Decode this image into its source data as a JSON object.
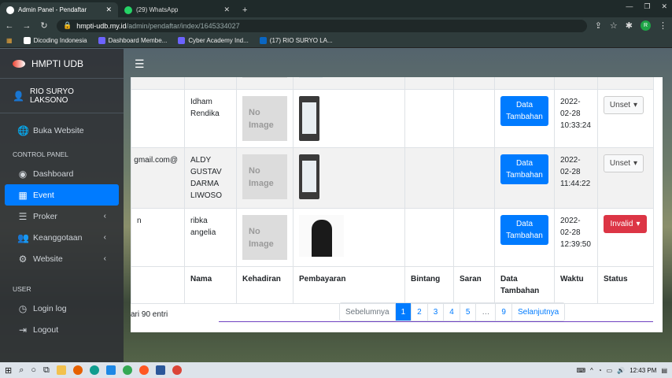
{
  "browser": {
    "tabs": [
      {
        "title": "Admin Panel - Pendaftar",
        "active": true
      },
      {
        "title": "(29) WhatsApp",
        "active": false
      }
    ],
    "url_host": "hmpti-udb.my.id",
    "url_path": "/admin/pendaftar/index/1645334027",
    "profile_initial": "R",
    "bookmarks": [
      "Dicoding Indonesia",
      "Dashboard Membe...",
      "Cyber Academy Ind...",
      "(17) RIO SURYO LA..."
    ]
  },
  "sidebar": {
    "brand": "HMPTI UDB",
    "user": "RIO SURYO LAKSONO",
    "visit_site": "Buka Website",
    "section_control": "CONTROL PANEL",
    "items": [
      {
        "label": "Dashboard",
        "icon": "dashboard-icon",
        "active": false,
        "chevron": false
      },
      {
        "label": "Event",
        "icon": "calendar-icon",
        "active": true,
        "chevron": false
      },
      {
        "label": "Proker",
        "icon": "list-icon",
        "active": false,
        "chevron": true
      },
      {
        "label": "Keanggotaan",
        "icon": "users-icon",
        "active": false,
        "chevron": true
      },
      {
        "label": "Website",
        "icon": "cogs-icon",
        "active": false,
        "chevron": true
      }
    ],
    "section_user": "USER",
    "user_items": [
      {
        "label": "Login log",
        "icon": "history-icon"
      },
      {
        "label": "Logout",
        "icon": "sign-out-icon"
      }
    ]
  },
  "table": {
    "rows": [
      {
        "email": "",
        "nama": "Idham Rendika",
        "kehadiran": "No Image",
        "pembayaran": "phone-screenshot",
        "bintang": "",
        "saran": "",
        "data_tambahan": "Data Tambahan",
        "waktu": "2022-02-28 10:33:24",
        "status": "Unset"
      },
      {
        "email": "@gmail.com",
        "nama": "ALDY GUSTAV DARMA LIWOSO",
        "kehadiran": "No Image",
        "pembayaran": "phone-screenshot",
        "bintang": "",
        "saran": "",
        "data_tambahan": "Data Tambahan",
        "waktu": "2022-02-28 11:44:22",
        "status": "Unset"
      },
      {
        "email": "n",
        "nama": "ribka angelia",
        "kehadiran": "No Image",
        "pembayaran": "person-photo",
        "bintang": "",
        "saran": "",
        "data_tambahan": "Data Tambahan",
        "waktu": "2022-02-28 12:39:50",
        "status": "Invalid"
      }
    ],
    "footer_headers": {
      "nama": "Nama",
      "kehadiran": "Kehadiran",
      "pembayaran": "Pembayaran",
      "bintang": "Bintang",
      "saran": "Saran",
      "data_tambahan": "Data Tambahan",
      "waktu": "Waktu",
      "status": "Status"
    },
    "entries_info": "ari 90 entri"
  },
  "pagination": {
    "prev": "Sebelumnya",
    "pages": [
      "1",
      "2",
      "3",
      "4",
      "5",
      "…",
      "9"
    ],
    "current": "1",
    "next": "Selanjutnya"
  },
  "taskbar": {
    "time": "12:43 PM"
  },
  "colors": {
    "primary": "#007bff",
    "danger": "#dc3545",
    "sidebar": "#343a40"
  }
}
